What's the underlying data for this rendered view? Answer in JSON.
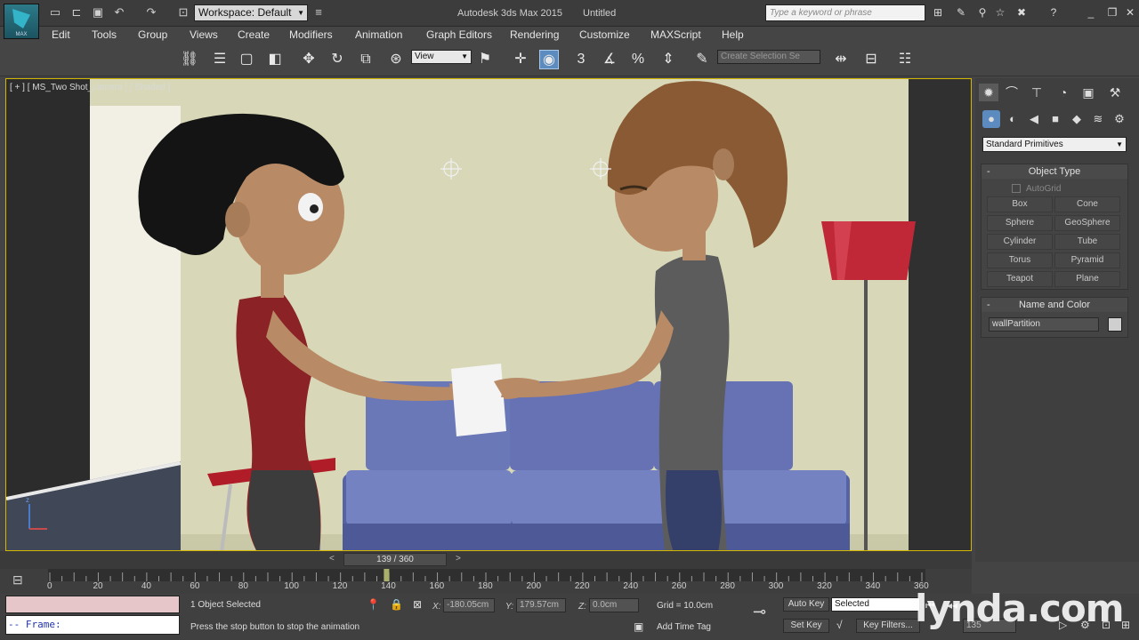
{
  "app": {
    "title": "Autodesk 3ds Max 2015",
    "document": "Untitled",
    "workspace_label": "Workspace: Default",
    "search_placeholder": "Type a keyword or phrase",
    "logo_text": "MAX"
  },
  "menubar": {
    "items": [
      "Edit",
      "Tools",
      "Group",
      "Views",
      "Create",
      "Modifiers",
      "Animation",
      "Graph Editors",
      "Rendering",
      "Customize",
      "MAXScript",
      "Help"
    ]
  },
  "toolbar": {
    "ref_coord": "View",
    "selection_set_placeholder": "Create Selection Se"
  },
  "viewport": {
    "label": "[ + ] [ MS_Two Shot_camera ] [ Shaded ]"
  },
  "command_panel": {
    "category": "Standard Primitives",
    "object_type_title": "Object Type",
    "autogrid_label": "AutoGrid",
    "primitives": [
      "Box",
      "Cone",
      "Sphere",
      "GeoSphere",
      "Cylinder",
      "Tube",
      "Torus",
      "Pyramid",
      "Teapot",
      "Plane"
    ],
    "name_color_title": "Name and Color",
    "object_name": "wallPartition",
    "object_color": "#cfcfcf"
  },
  "timeline": {
    "current_frame": 139,
    "total_frames": 360,
    "frame_display": "139 / 360",
    "tick_labels": [
      "0",
      "20",
      "40",
      "60",
      "80",
      "100",
      "120",
      "140",
      "160",
      "180",
      "200",
      "220",
      "240",
      "260",
      "280",
      "300",
      "320",
      "340",
      "360"
    ]
  },
  "status": {
    "script_prompt": "-- Frame:",
    "selection_text": "1 Object Selected",
    "prompt_text": "Press the stop button to stop the animation",
    "x_label": "X:",
    "y_label": "Y:",
    "z_label": "Z:",
    "x_value": "-180.05cm",
    "y_value": "179.57cm",
    "z_value": "0.0cm",
    "grid": "Grid = 10.0cm",
    "add_time_tag": "Add Time Tag",
    "auto_key": "Auto Key",
    "set_key": "Set Key",
    "key_mode": "Selected",
    "key_filters": "Key Filters...",
    "frame_value": "135"
  },
  "watermark": "lynda.com",
  "colors": {
    "viewport_border": "#d4b800",
    "active_button": "#5b8bbf",
    "wall": "#d8d8b8",
    "sofa": "#6a78b8",
    "lamp_shade": "#c02838",
    "shirt_left": "#8a2226"
  }
}
